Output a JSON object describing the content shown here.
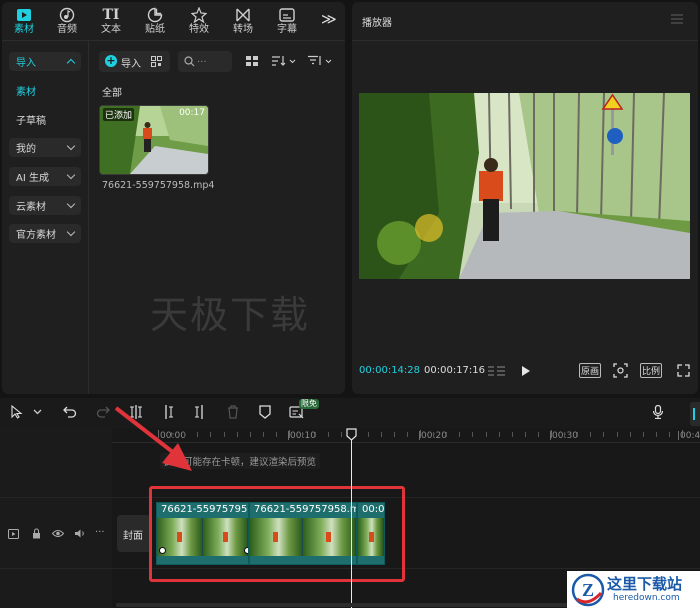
{
  "tabs": [
    {
      "label": "素材",
      "icon": "media-icon",
      "active": true
    },
    {
      "label": "音频",
      "icon": "audio-icon",
      "active": false
    },
    {
      "label": "文本",
      "icon": "text-icon",
      "active": false
    },
    {
      "label": "贴纸",
      "icon": "sticker-icon",
      "active": false
    },
    {
      "label": "特效",
      "icon": "effects-icon",
      "active": false
    },
    {
      "label": "转场",
      "icon": "transition-icon",
      "active": false
    },
    {
      "label": "字幕",
      "icon": "subtitle-icon",
      "active": false
    }
  ],
  "more_glyph": "≫",
  "sidebar": {
    "import_label": "导入",
    "items": [
      "素材",
      "子草稿",
      "我的",
      "AI 生成",
      "云素材",
      "官方素材"
    ]
  },
  "media": {
    "import_button": "导入",
    "search_placeholder": "...",
    "section_label": "全部",
    "clip_badge": "已添加",
    "clip_duration": "00:17",
    "clip_name": "76621-559757958.mp4"
  },
  "watermark": "天极下载",
  "player": {
    "title": "播放器",
    "current_time": "00:00:14:28",
    "total_time": "00:00:17:16",
    "btn_original": "原画",
    "btn_ratio": "比例"
  },
  "toolbar": {
    "free_badge": "限免"
  },
  "timeline": {
    "ticks": [
      "00:00",
      "|00:10",
      "|00:20",
      "|00:30",
      "|00:4"
    ],
    "hint": "此处可能存在卡顿，建议渲染后预览",
    "cover_label": "封面",
    "clips": [
      {
        "title": "76621-559757958.m"
      },
      {
        "title": "76621-559757958.mp4"
      },
      {
        "title": "00:00"
      }
    ]
  },
  "logo": {
    "letter": "Z",
    "name": "这里下载站",
    "url": "heredown.com"
  },
  "colors": {
    "accent": "#1fd1e0",
    "highlight": "#e0333a"
  }
}
